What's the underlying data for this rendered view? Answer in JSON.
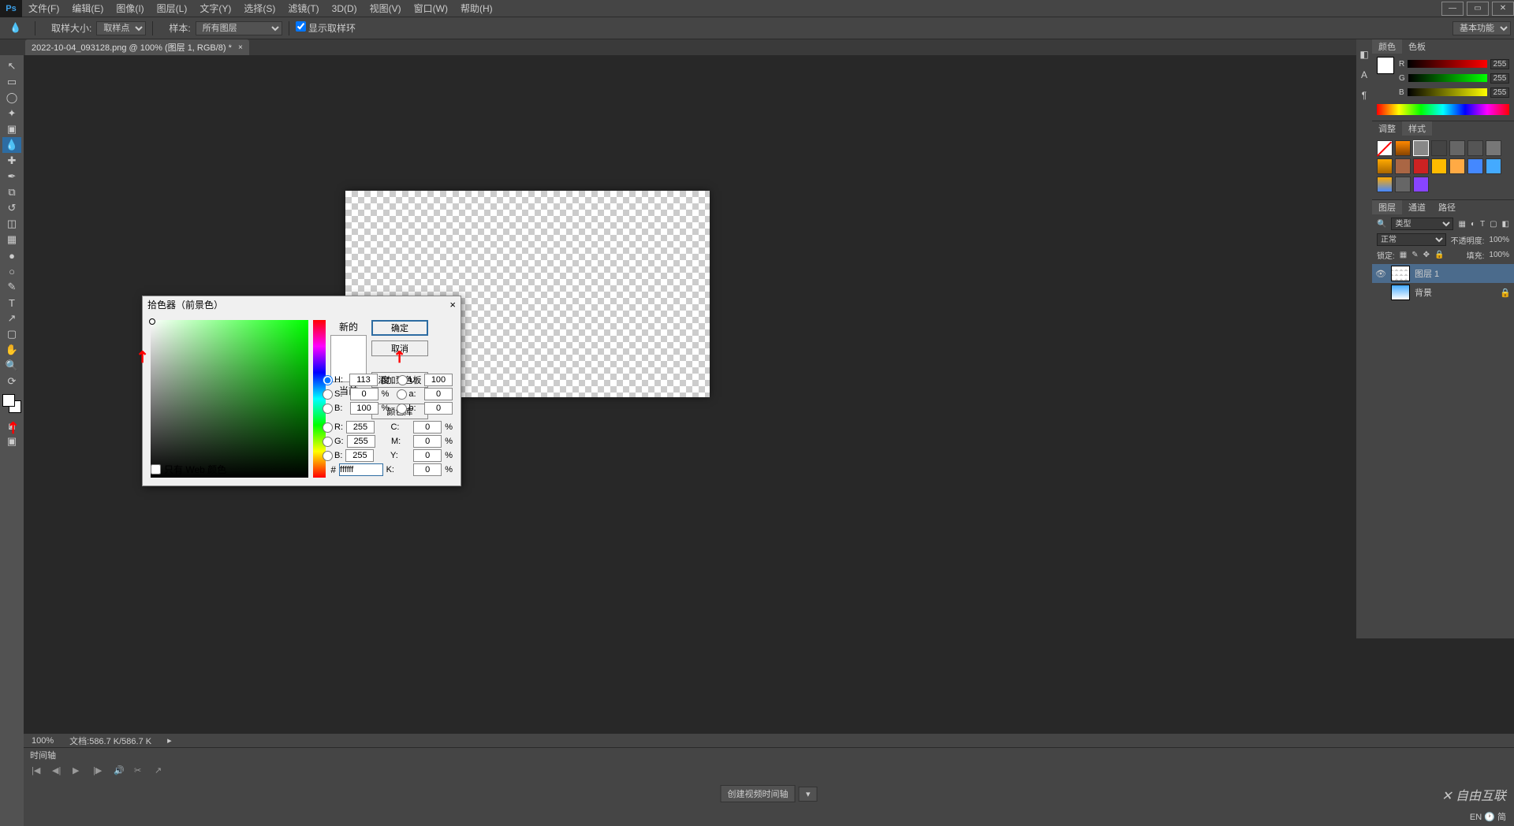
{
  "app": {
    "logo": "Ps"
  },
  "menu": [
    "文件(F)",
    "编辑(E)",
    "图像(I)",
    "图层(L)",
    "文字(Y)",
    "选择(S)",
    "滤镜(T)",
    "3D(D)",
    "视图(V)",
    "窗口(W)",
    "帮助(H)"
  ],
  "window_controls": {
    "min": "—",
    "max": "▭",
    "close": "✕"
  },
  "options": {
    "sample_size_label": "取样大小:",
    "sample_size_value": "取样点",
    "sample_label": "样本:",
    "sample_value": "所有图层",
    "show_ring": "显示取样环",
    "workspace": "基本功能"
  },
  "doc_tab": {
    "name": "2022-10-04_093128.png @ 100% (图层 1, RGB/8) *",
    "close": "×"
  },
  "status": {
    "zoom": "100%",
    "doc_info": "文档:586.7 K/586.7 K"
  },
  "timeline": {
    "title": "时间轴",
    "create": "创建视频时间轴"
  },
  "panels": {
    "color_tab": "颜色",
    "swatches_tab": "色板",
    "r": "R",
    "g": "G",
    "b": "B",
    "rv": "255",
    "gv": "255",
    "bv": "255",
    "adjust_tab": "调整",
    "styles_tab": "样式",
    "layers_tab": "图层",
    "channels_tab": "通道",
    "paths_tab": "路径",
    "kind_label": "类型",
    "blend_mode": "正常",
    "opacity_label": "不透明度:",
    "opacity_val": "100%",
    "lock_label": "锁定:",
    "fill_label": "填充:",
    "fill_val": "100%",
    "layer1": "图层 1",
    "bg_layer": "背景"
  },
  "mini_dock": [
    "◧",
    "A",
    "¶"
  ],
  "dialog": {
    "title": "拾色器（前景色）",
    "close": "×",
    "new_label": "新的",
    "current_label": "当前",
    "ok": "确定",
    "cancel": "取消",
    "add_swatch": "添加到色板",
    "color_lib": "颜色库",
    "web_only": "只有 Web 颜色",
    "hex_label": "#",
    "hex_val": "ffffff",
    "H": "113",
    "S": "0",
    "Bv": "100",
    "L": "100",
    "a": "0",
    "b_lab": "0",
    "R": "255",
    "G": "255",
    "B_rgb": "255",
    "C": "0",
    "M": "0",
    "Y": "0",
    "K": "0",
    "deg": "度",
    "pct": "%"
  },
  "footer": {
    "lang": "EN 🕐 简"
  },
  "watermark": "✕ 自由互联"
}
